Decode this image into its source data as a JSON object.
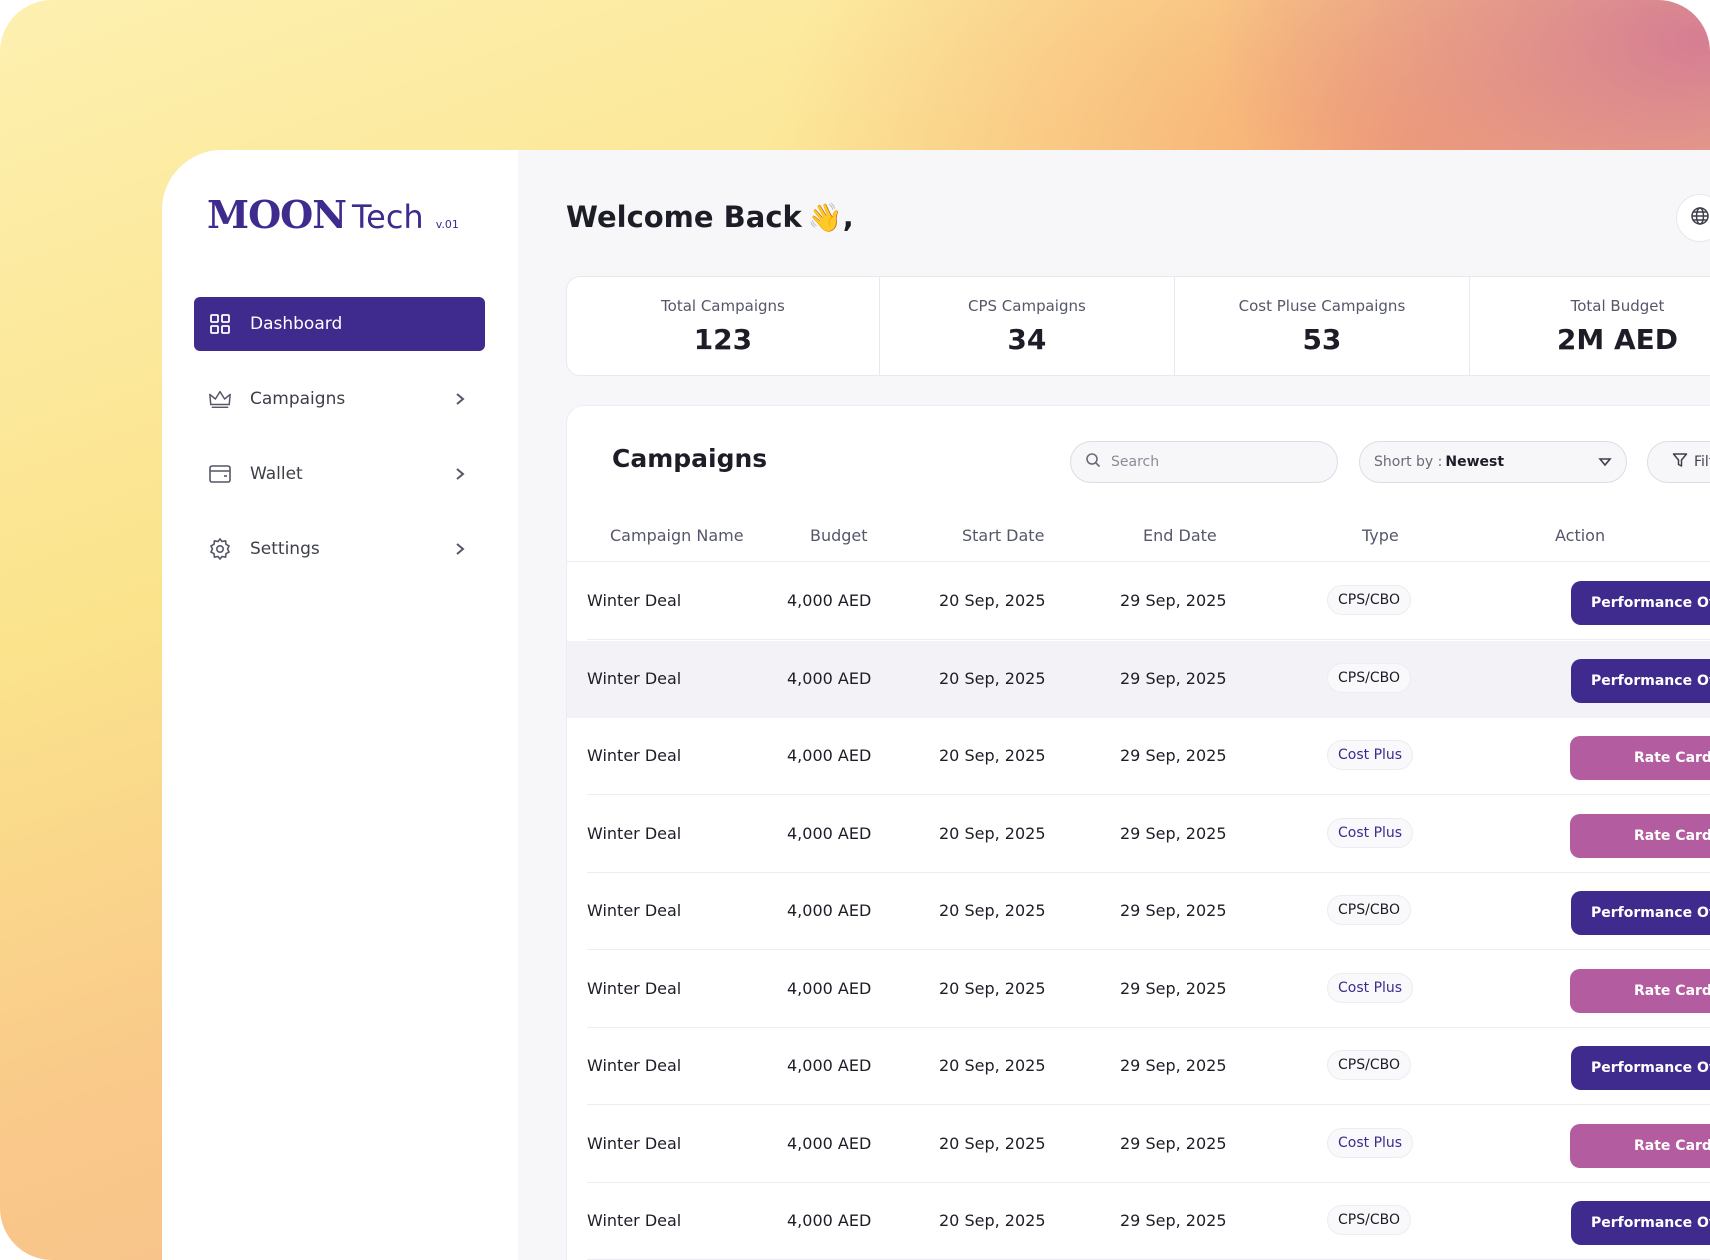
{
  "brand": {
    "name": "MOON",
    "suffix": "Tech",
    "version": "v.01"
  },
  "sidebar": {
    "items": [
      {
        "label": "Dashboard",
        "icon": "grid-icon",
        "active": true
      },
      {
        "label": "Campaigns",
        "icon": "crown-icon"
      },
      {
        "label": "Wallet",
        "icon": "wallet-icon"
      },
      {
        "label": "Settings",
        "icon": "gear-icon"
      }
    ]
  },
  "header": {
    "greeting": "Welcome Back",
    "emoji": "👋",
    "suffix": ","
  },
  "stats": [
    {
      "label": "Total Campaigns",
      "value": "123"
    },
    {
      "label": "CPS Campaigns",
      "value": "34"
    },
    {
      "label": "Cost Pluse Campaigns",
      "value": "53"
    },
    {
      "label": "Total Budget",
      "value": "2M AED"
    }
  ],
  "campaigns": {
    "title": "Campaigns",
    "search_placeholder": "Search",
    "sort_label": "Short by :",
    "sort_value": "Newest",
    "filter_label": "Filter",
    "columns": [
      "Campaign Name",
      "Budget",
      "Start Date",
      "End Date",
      "Type",
      "Action"
    ],
    "rows": [
      {
        "name": "Winter Deal",
        "budget": "4,000 AED",
        "start": "20 Sep, 2025",
        "end": "29 Sep, 2025",
        "type": "CPS/CBO",
        "action": "Performance Overview"
      },
      {
        "name": "Winter Deal",
        "budget": "4,000 AED",
        "start": "20 Sep, 2025",
        "end": "29 Sep, 2025",
        "type": "CPS/CBO",
        "action": "Performance Overview"
      },
      {
        "name": "Winter Deal",
        "budget": "4,000 AED",
        "start": "20 Sep, 2025",
        "end": "29 Sep, 2025",
        "type": "Cost Plus",
        "action": "Rate Card"
      },
      {
        "name": "Winter Deal",
        "budget": "4,000 AED",
        "start": "20 Sep, 2025",
        "end": "29 Sep, 2025",
        "type": "Cost Plus",
        "action": "Rate Card"
      },
      {
        "name": "Winter Deal",
        "budget": "4,000 AED",
        "start": "20 Sep, 2025",
        "end": "29 Sep, 2025",
        "type": "CPS/CBO",
        "action": "Performance Overview"
      },
      {
        "name": "Winter Deal",
        "budget": "4,000 AED",
        "start": "20 Sep, 2025",
        "end": "29 Sep, 2025",
        "type": "Cost Plus",
        "action": "Rate Card"
      },
      {
        "name": "Winter Deal",
        "budget": "4,000 AED",
        "start": "20 Sep, 2025",
        "end": "29 Sep, 2025",
        "type": "CPS/CBO",
        "action": "Performance Overview"
      },
      {
        "name": "Winter Deal",
        "budget": "4,000 AED",
        "start": "20 Sep, 2025",
        "end": "29 Sep, 2025",
        "type": "Cost Plus",
        "action": "Rate Card"
      },
      {
        "name": "Winter Deal",
        "budget": "4,000 AED",
        "start": "20 Sep, 2025",
        "end": "29 Sep, 2025",
        "type": "CPS/CBO",
        "action": "Performance Overview"
      }
    ]
  },
  "colors": {
    "primary": "#3f2a8d",
    "rate": "#b35c9f"
  }
}
